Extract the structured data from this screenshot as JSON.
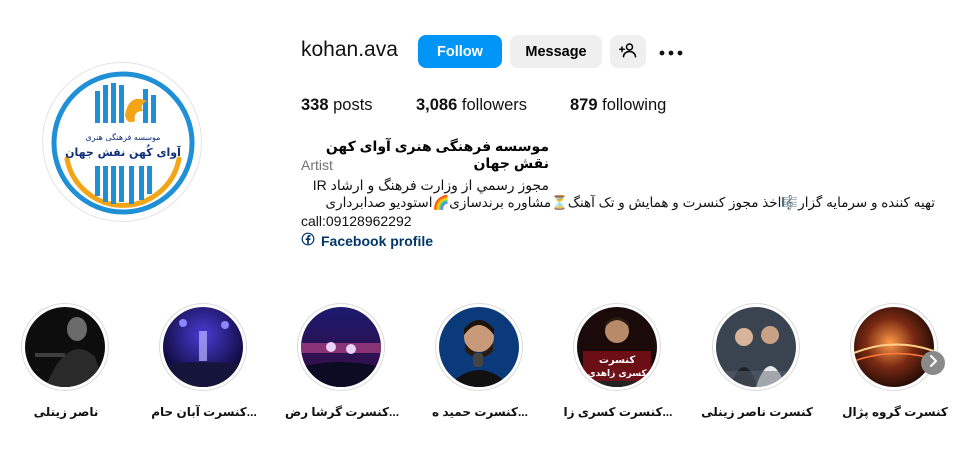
{
  "profile": {
    "username": "kohan.ava",
    "follow_label": "Follow",
    "message_label": "Message",
    "stats": {
      "posts_count": "338",
      "posts_label": "posts",
      "followers_count": "3,086",
      "followers_label": "followers",
      "following_count": "879",
      "following_label": "following"
    },
    "full_name": "موسسه فرهنگی هنری آوای کهن نقش جهان",
    "category": "Artist",
    "bio": {
      "line1": "مجوز رسمي از وزارت فرهنگ و ارشاد IR",
      "line2": "تهیه کننده و سرمایه گزار🎼اخذ مجوز کنسرت و همایش و تک آهنگ⏳مشاوره برندسازی🌈استودیو صدابرداری",
      "line3": "call:09128962292"
    },
    "link_label": "Facebook profile"
  },
  "avatar": {
    "logo_line1": "موسسه فرهنگی هنری",
    "logo_line2": "آوای کُهن نقش جهان",
    "colors": {
      "blue": "#1f8fd6",
      "orange": "#f2a516",
      "navy": "#0f2f7a"
    }
  },
  "highlights": [
    {
      "label": "ناصر زینلی"
    },
    {
      "label": "کنسرت آبان حام..."
    },
    {
      "label": "کنسرت گرشا رض..."
    },
    {
      "label": "کنسرت حمید ه..."
    },
    {
      "label": "کنسرت کسری زا...",
      "overlay_line1": "کنسرت",
      "overlay_line2": "کسری زاهدی"
    },
    {
      "label": "کنسرت ناصر زینلی"
    },
    {
      "label": "کنسرت گروه پژال"
    }
  ],
  "icons": {
    "add_user": "add-person-icon",
    "more": "more-options-icon",
    "link": "facebook-icon",
    "next": "chevron-right-icon"
  },
  "colors": {
    "follow_button": "#0095f6",
    "secondary_button": "#efefef",
    "link": "#00376b",
    "muted": "#737373"
  }
}
